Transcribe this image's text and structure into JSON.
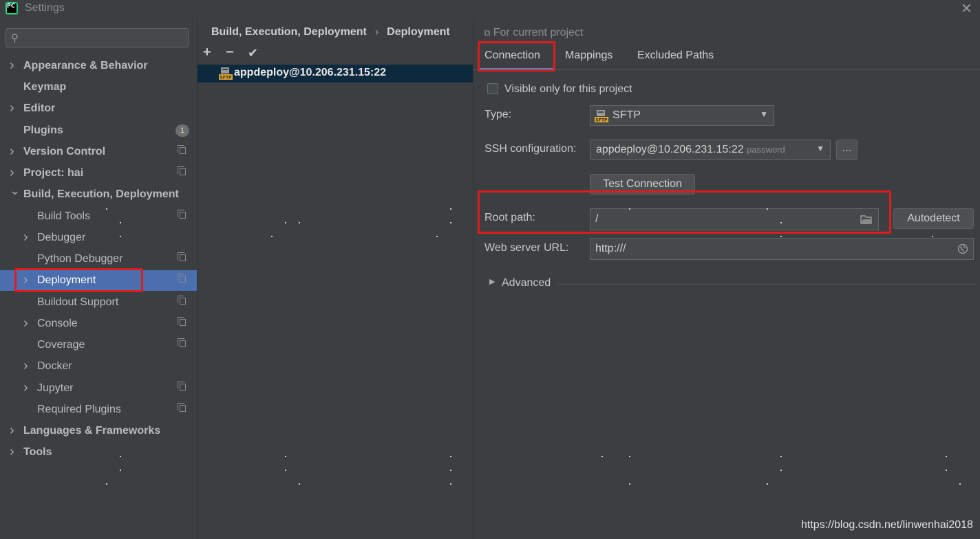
{
  "window": {
    "title": "Settings",
    "logo_text": "PC",
    "close_glyph": "✕"
  },
  "sidebar": {
    "search_placeholder": "",
    "items": [
      {
        "label": "Appearance & Behavior",
        "bold": true,
        "arrow": true,
        "level": 0
      },
      {
        "label": "Keymap",
        "bold": true,
        "arrow": false,
        "level": 0
      },
      {
        "label": "Editor",
        "bold": true,
        "arrow": true,
        "level": 0
      },
      {
        "label": "Plugins",
        "bold": true,
        "arrow": false,
        "level": 0,
        "badge": "1"
      },
      {
        "label": "Version Control",
        "bold": true,
        "arrow": true,
        "level": 0,
        "copy": true
      },
      {
        "label": "Project: hai",
        "bold": true,
        "arrow": true,
        "level": 0,
        "copy": true
      },
      {
        "label": "Build, Execution, Deployment",
        "bold": true,
        "arrow": "down",
        "level": 0
      },
      {
        "label": "Build Tools",
        "bold": false,
        "arrow": false,
        "level": 1,
        "copy": true
      },
      {
        "label": "Debugger",
        "bold": false,
        "arrow": true,
        "level": 1
      },
      {
        "label": "Python Debugger",
        "bold": false,
        "arrow": false,
        "level": 1,
        "copy": true
      },
      {
        "label": "Deployment",
        "bold": false,
        "arrow": true,
        "level": 1,
        "copy": true,
        "selected": true
      },
      {
        "label": "Buildout Support",
        "bold": false,
        "arrow": false,
        "level": 1,
        "copy": true
      },
      {
        "label": "Console",
        "bold": false,
        "arrow": true,
        "level": 1,
        "copy": true
      },
      {
        "label": "Coverage",
        "bold": false,
        "arrow": false,
        "level": 1,
        "copy": true
      },
      {
        "label": "Docker",
        "bold": false,
        "arrow": true,
        "level": 1
      },
      {
        "label": "Jupyter",
        "bold": false,
        "arrow": true,
        "level": 1,
        "copy": true
      },
      {
        "label": "Required Plugins",
        "bold": false,
        "arrow": false,
        "level": 1,
        "copy": true
      },
      {
        "label": "Languages & Frameworks",
        "bold": true,
        "arrow": true,
        "level": 0
      },
      {
        "label": "Tools",
        "bold": true,
        "arrow": true,
        "level": 0
      }
    ]
  },
  "breadcrumb": {
    "parent": "Build, Execution, Deployment",
    "separator": "›",
    "current": "Deployment"
  },
  "toolbar": {
    "add": "+",
    "remove": "−",
    "apply": "✔"
  },
  "servers": [
    {
      "name": "appdeploy@10.206.231.15:22",
      "icon_text": "SFTP"
    }
  ],
  "right": {
    "scope_label": "For current project",
    "tabs": [
      "Connection",
      "Mappings",
      "Excluded Paths"
    ],
    "active_tab": "Connection",
    "visible_only_label": "Visible only for this project",
    "visible_only_checked": false,
    "type_label": "Type:",
    "type_value": "SFTP",
    "ssh_label": "SSH configuration:",
    "ssh_value": "appdeploy@10.206.231.15:22",
    "ssh_auth": "password",
    "ellipsis_button": "...",
    "test_button": "Test Connection",
    "root_path_label": "Root path:",
    "root_path_value": "/",
    "autodetect_button": "Autodetect",
    "web_url_label": "Web server URL:",
    "web_url_value": "http:///",
    "advanced_label": "Advanced"
  },
  "watermark": "https://blog.csdn.net/linwenhai2018",
  "colors": {
    "accent": "#4b6eaf",
    "highlight_border": "#e01b1b",
    "selected_server_row": "#0d293e"
  }
}
